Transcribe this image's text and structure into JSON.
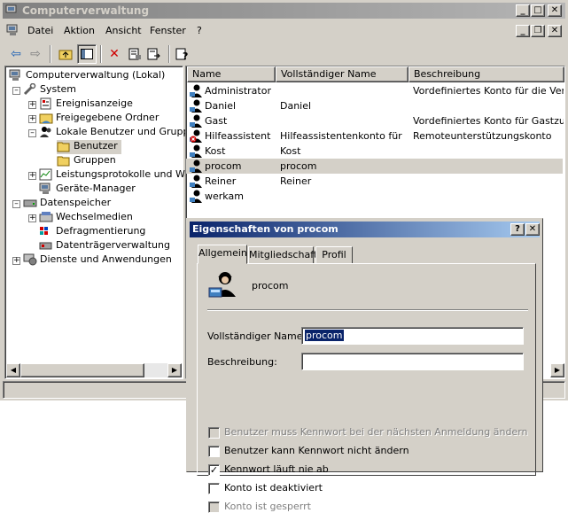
{
  "window": {
    "title": "Computerverwaltung"
  },
  "menu": [
    "Datei",
    "Aktion",
    "Ansicht",
    "Fenster",
    "?"
  ],
  "tree": {
    "root": "Computerverwaltung (Lokal)",
    "system": "System",
    "ereignis": "Ereignisanzeige",
    "freigabe": "Freigegebene Ordner",
    "lokale": "Lokale Benutzer und Gruppen",
    "benutzer": "Benutzer",
    "gruppen": "Gruppen",
    "leistung": "Leistungsprotokolle und Warn",
    "geraete": "Geräte-Manager",
    "datenspeicher": "Datenspeicher",
    "wechsel": "Wechselmedien",
    "defrag": "Defragmentierung",
    "datentraeger": "Datenträgerverwaltung",
    "dienste": "Dienste und Anwendungen"
  },
  "list": {
    "columns": [
      "Name",
      "Vollständiger Name",
      "Beschreibung"
    ],
    "rows": [
      {
        "name": "Administrator",
        "full": "",
        "desc": "Vordefiniertes Konto für die Verwal"
      },
      {
        "name": "Daniel",
        "full": "Daniel",
        "desc": ""
      },
      {
        "name": "Gast",
        "full": "",
        "desc": "Vordefiniertes Konto für Gastzugrif"
      },
      {
        "name": "Hilfeassistent",
        "full": "Hilfeassistentenkonto für ...",
        "desc": "Remoteunterstützungskonto"
      },
      {
        "name": "Kost",
        "full": "Kost",
        "desc": ""
      },
      {
        "name": "procom",
        "full": "procom",
        "desc": ""
      },
      {
        "name": "Reiner",
        "full": "Reiner",
        "desc": ""
      },
      {
        "name": "werkam",
        "full": "",
        "desc": ""
      }
    ]
  },
  "dialog": {
    "title": "Eigenschaften von procom",
    "tabs": [
      "Allgemein",
      "Mitgliedschaft",
      "Profil"
    ],
    "username": "procom",
    "fullname_label": "Vollständiger Name:",
    "fullname_value": "procom",
    "desc_label": "Beschreibung:",
    "desc_value": "",
    "checkboxes": [
      {
        "label": "Benutzer muss Kennwort bei der nächsten Anmeldung ändern",
        "checked": false,
        "disabled": true
      },
      {
        "label": "Benutzer kann Kennwort nicht ändern",
        "checked": false,
        "disabled": false
      },
      {
        "label": "Kennwort läuft nie ab",
        "checked": true,
        "disabled": false
      },
      {
        "label": "Konto ist deaktiviert",
        "checked": false,
        "disabled": false
      },
      {
        "label": "Konto ist gesperrt",
        "checked": false,
        "disabled": true
      }
    ],
    "help_glyph": "?",
    "close_glyph": "✕"
  }
}
